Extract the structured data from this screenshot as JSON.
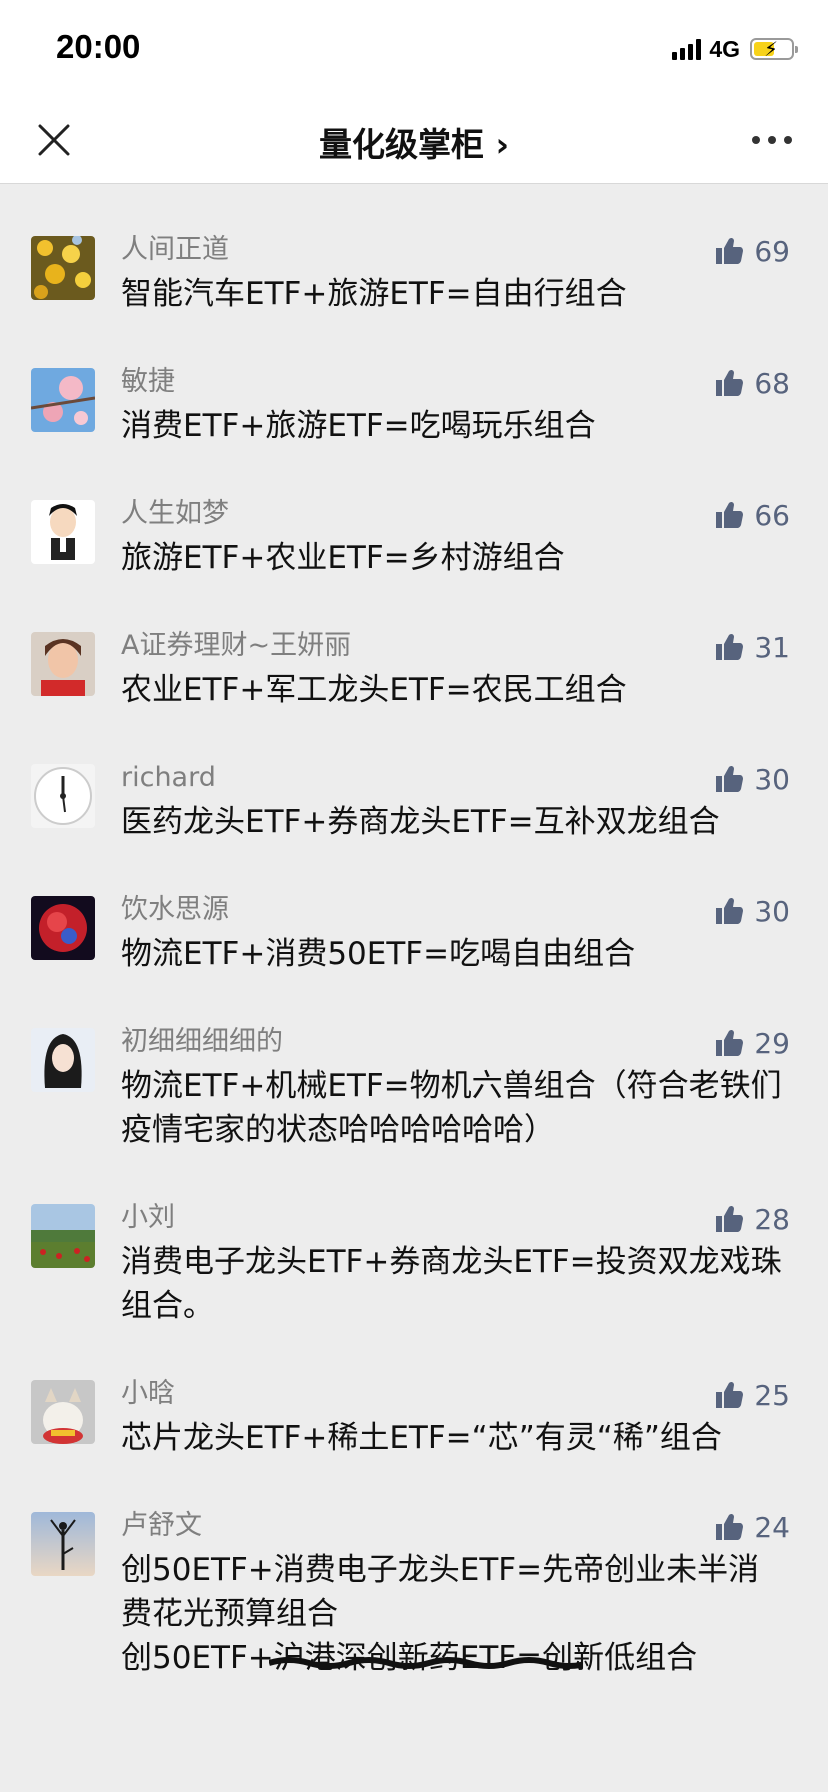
{
  "status_bar": {
    "time": "20:00",
    "network": "4G",
    "battery_level": 0.55
  },
  "nav": {
    "title": "量化级掌柜 ›"
  },
  "colors": {
    "like_blue": "#57637d",
    "background": "#ededed"
  },
  "comments": [
    {
      "user": "人间正道",
      "likes": "69",
      "text": "智能汽车ETF+旅游ETF=自由行组合",
      "avatar": "yellow-flowers"
    },
    {
      "user": "敏捷",
      "likes": "68",
      "text": "消费ETF+旅游ETF=吃喝玩乐组合",
      "avatar": "pink-blossom"
    },
    {
      "user": "人生如梦",
      "likes": "66",
      "text": "旅游ETF+农业ETF=乡村游组合",
      "avatar": "cartoon-man"
    },
    {
      "user": "A证券理财~王妍丽",
      "likes": "31",
      "text": "农业ETF+军工龙头ETF=农民工组合",
      "avatar": "woman-photo"
    },
    {
      "user": "richard",
      "likes": "30",
      "text": "医药龙头ETF+券商龙头ETF=互补双龙组合",
      "avatar": "clock"
    },
    {
      "user": "饮水思源",
      "likes": "30",
      "text": "物流ETF+消费50ETF=吃喝自由组合",
      "avatar": "red-globe"
    },
    {
      "user": "初细细细细的",
      "likes": "29",
      "text": "物流ETF+机械ETF=物机六兽组合（符合老铁们疫情宅家的状态哈哈哈哈哈哈）",
      "avatar": "woman-dark-hair"
    },
    {
      "user": "小刘",
      "likes": "28",
      "text": "消费电子龙头ETF+券商龙头ETF=投资双龙戏珠组合。",
      "avatar": "landscape"
    },
    {
      "user": "小晗",
      "likes": "25",
      "text": "芯片龙头ETF+稀土ETF=“芯”有灵“稀”组合",
      "avatar": "cat"
    },
    {
      "user": "卢舒文",
      "likes": "24",
      "text": "创50ETF+消费电子龙头ETF=先帝创业未半消费花光预算组合",
      "text2": "创50ETF+沪港深创新药ETF=创新低组合",
      "avatar": "yoga-silhouette"
    }
  ]
}
